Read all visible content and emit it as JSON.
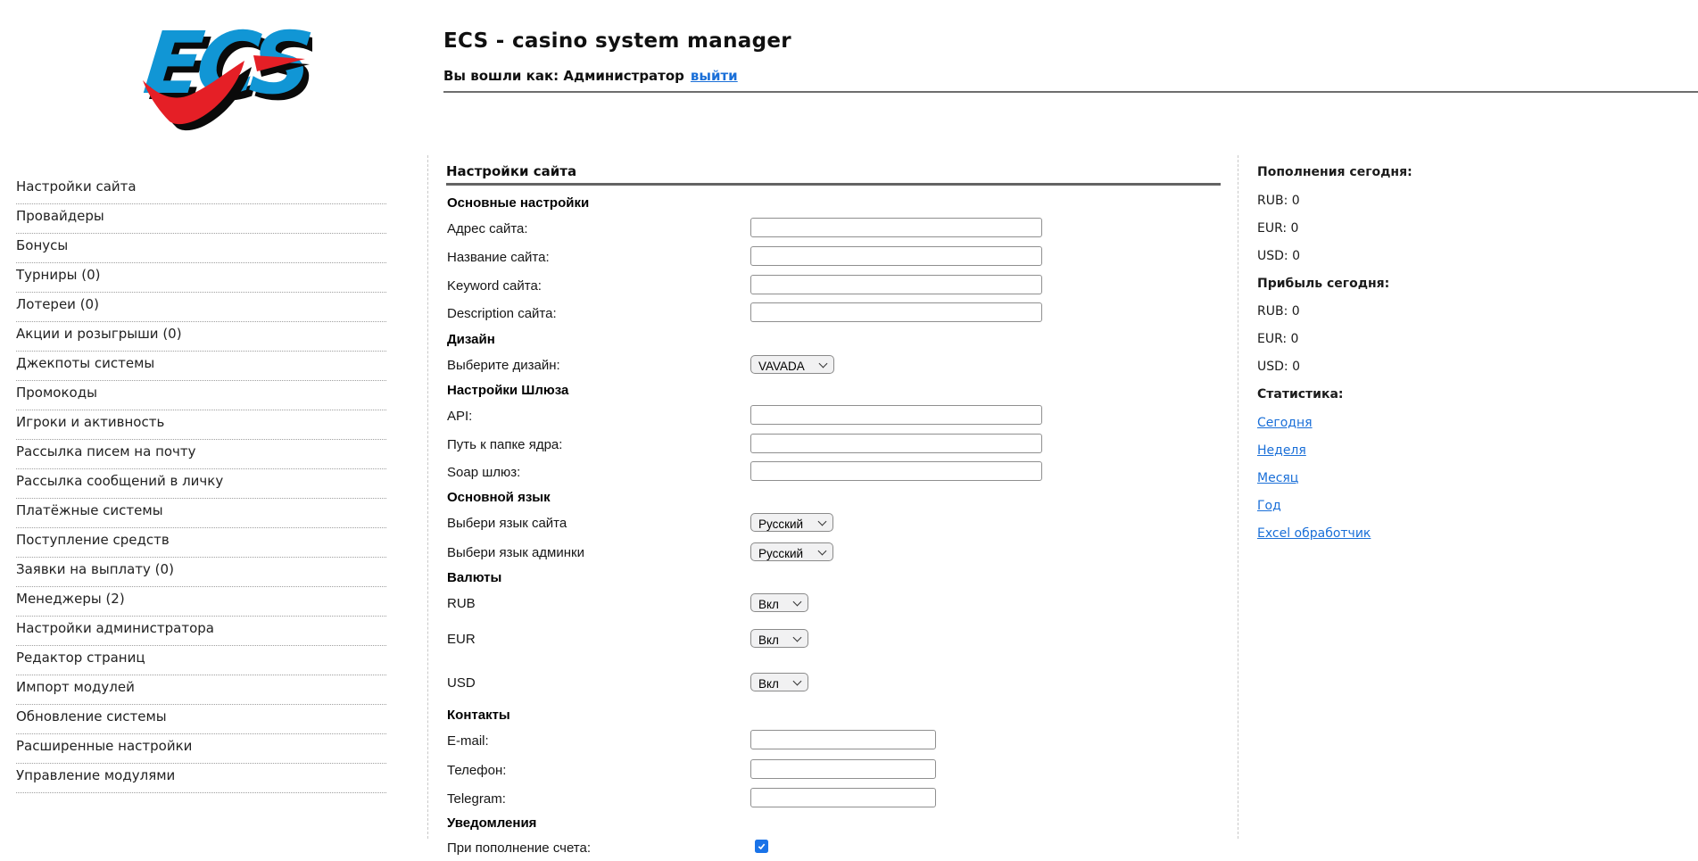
{
  "logo": {
    "text": "ECS"
  },
  "header": {
    "title": "ECS - casino system manager",
    "logged_in_text": "Вы вошли как: Администратор",
    "logout_label": "выйти"
  },
  "sidebar": {
    "items": [
      "Настройки сайта",
      "Провайдеры",
      "Бонусы",
      "Турниры (0)",
      "Лотереи (0)",
      "Акции и розыгрыши (0)",
      "Джекпоты системы",
      "Промокоды",
      "Игроки и активность",
      "Рассылка писем на почту",
      "Рассылка сообщений в личку",
      "Платёжные системы",
      "Поступление средств",
      "Заявки на выплату (0)",
      "Менеджеры (2)",
      "Настройки администратора",
      "Редактор страниц",
      "Импорт модулей",
      "Обновление системы",
      "Расширенные настройки",
      "Управление модулями"
    ]
  },
  "main": {
    "title": "Настройки сайта",
    "form": {
      "rows": [
        {
          "label": "Основные настройки"
        },
        {
          "label": "Адрес сайта:",
          "value": ""
        },
        {
          "label": "Название сайта:",
          "value": ""
        },
        {
          "label": "Keyword сайта:",
          "value": ""
        },
        {
          "label": "Description сайта:",
          "value": ""
        },
        {
          "label": "Дизайн"
        },
        {
          "label": "Выберите дизайн:",
          "value": "VAVADA"
        },
        {
          "label": "Настройки Шлюза"
        },
        {
          "label": "API:",
          "value": ""
        },
        {
          "label": "Путь к папке ядра:",
          "value": ""
        },
        {
          "label": "Soap шлюз:",
          "value": ""
        },
        {
          "label": "Основной язык"
        },
        {
          "label": "Выбери язык сайта",
          "value": "Русский"
        },
        {
          "label": "Выбери язык админки",
          "value": "Русский"
        },
        {
          "label": "Валюты"
        },
        {
          "label": "RUB",
          "value": "Вкл"
        },
        {
          "label": "EUR",
          "value": "Вкл"
        },
        {
          "label": "USD",
          "value": "Вкл"
        },
        {
          "label": "Контакты"
        },
        {
          "label": "E-mail:",
          "value": ""
        },
        {
          "label": "Телефон:",
          "value": ""
        },
        {
          "label": "Telegram:",
          "value": ""
        },
        {
          "label": "Уведомления"
        },
        {
          "label": "При пополнение счета:",
          "checked": true
        }
      ]
    }
  },
  "right_panel": {
    "deposits": {
      "title": "Пополнения сегодня:",
      "items": [
        "RUB: 0",
        "EUR: 0",
        "USD: 0"
      ]
    },
    "profit": {
      "title": "Прибыль сегодня:",
      "items": [
        "RUB: 0",
        "EUR: 0",
        "USD: 0"
      ]
    },
    "stats": {
      "title": "Статистика:",
      "links": [
        "Сегодня",
        "Неделя",
        "Месяц",
        "Год",
        "Excel обработчик"
      ]
    }
  },
  "colors": {
    "link_blue": "#1a6fd8",
    "logo_blue": "#1196d5",
    "logo_red": "#e51f26",
    "checkbox_blue": "#1a73e8",
    "rule_gray": "#6e6e6e"
  }
}
